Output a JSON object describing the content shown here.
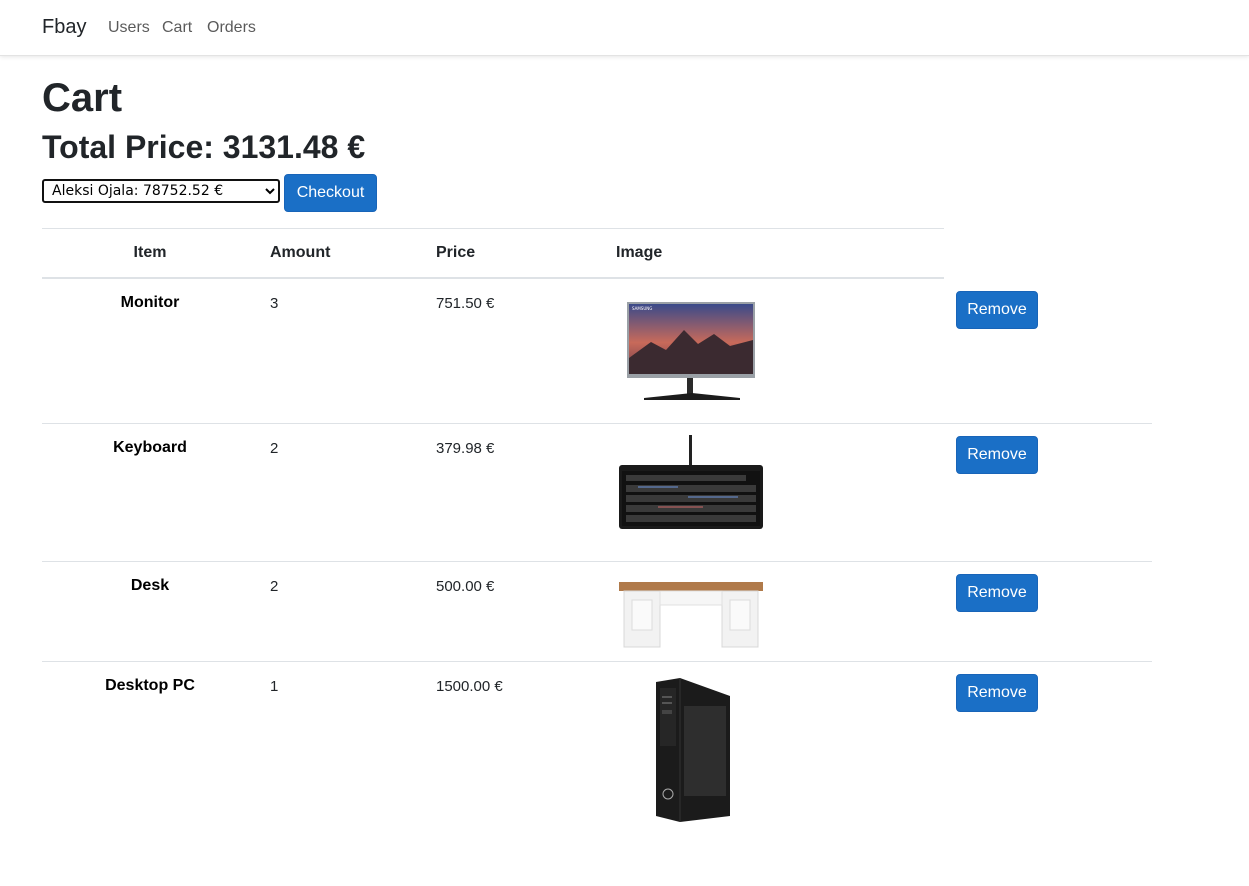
{
  "navbar": {
    "brand": "Fbay",
    "links": [
      "Users",
      "Cart",
      "Orders"
    ]
  },
  "page": {
    "title": "Cart",
    "total_label": "Total Price: 3131.48 €"
  },
  "user_select": {
    "selected": "Aleksi Ojala: 78752.52 €"
  },
  "checkout_label": "Checkout",
  "table": {
    "headers": [
      "Item",
      "Amount",
      "Price",
      "Image"
    ],
    "rows": [
      {
        "item": "Monitor",
        "amount": "3",
        "price": "751.50 €",
        "image_icon": "monitor-image",
        "remove_label": "Remove"
      },
      {
        "item": "Keyboard",
        "amount": "2",
        "price": "379.98 €",
        "image_icon": "keyboard-image",
        "remove_label": "Remove"
      },
      {
        "item": "Desk",
        "amount": "2",
        "price": "500.00 €",
        "image_icon": "desk-image",
        "remove_label": "Remove"
      },
      {
        "item": "Desktop PC",
        "amount": "1",
        "price": "1500.00 €",
        "image_icon": "desktop-pc-image",
        "remove_label": "Remove"
      }
    ]
  },
  "colors": {
    "primary_button": "#1a6fc6",
    "border": "#dee2e6"
  }
}
